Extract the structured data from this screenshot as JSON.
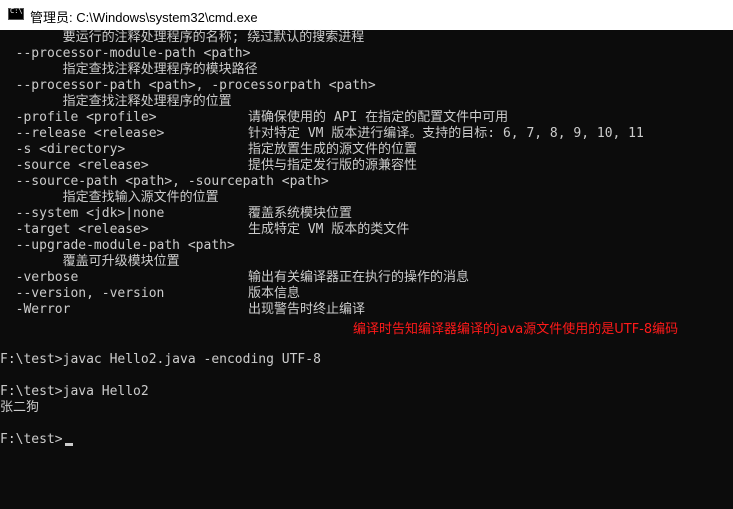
{
  "window": {
    "title": "管理员: C:\\Windows\\system32\\cmd.exe",
    "icon": "cmd-icon"
  },
  "console": {
    "lines": [
      {
        "opt": "        要运行的注释处理程序的名称; 绕过默认的搜索进程",
        "desc": ""
      },
      {
        "opt": "  --processor-module-path <path>",
        "desc": ""
      },
      {
        "opt": "        指定查找注释处理程序的模块路径",
        "desc": ""
      },
      {
        "opt": "  --processor-path <path>, -processorpath <path>",
        "desc": ""
      },
      {
        "opt": "        指定查找注释处理程序的位置",
        "desc": ""
      },
      {
        "opt": "  -profile <profile>",
        "desc": "请确保使用的 API 在指定的配置文件中可用"
      },
      {
        "opt": "  --release <release>",
        "desc": "针对特定 VM 版本进行编译。支持的目标: 6, 7, 8, 9, 10, 11"
      },
      {
        "opt": "  -s <directory>",
        "desc": "指定放置生成的源文件的位置"
      },
      {
        "opt": "  -source <release>",
        "desc": "提供与指定发行版的源兼容性"
      },
      {
        "opt": "  --source-path <path>, -sourcepath <path>",
        "desc": ""
      },
      {
        "opt": "        指定查找输入源文件的位置",
        "desc": ""
      },
      {
        "opt": "  --system <jdk>|none",
        "desc": "覆盖系统模块位置"
      },
      {
        "opt": "  -target <release>",
        "desc": "生成特定 VM 版本的类文件"
      },
      {
        "opt": "  --upgrade-module-path <path>",
        "desc": ""
      },
      {
        "opt": "        覆盖可升级模块位置",
        "desc": ""
      },
      {
        "opt": "  -verbose",
        "desc": "输出有关编译器正在执行的操作的消息"
      },
      {
        "opt": "  --version, -version",
        "desc": "版本信息"
      },
      {
        "opt": "  -Werror",
        "desc": "出现警告时终止编译"
      },
      {
        "opt": "",
        "desc": ""
      },
      {
        "opt": "",
        "desc": ""
      },
      {
        "opt": "F:\\test>javac Hello2.java -encoding UTF-8",
        "desc": ""
      },
      {
        "opt": "",
        "desc": ""
      },
      {
        "opt": "F:\\test>java Hello2",
        "desc": ""
      },
      {
        "opt": "张二狗",
        "desc": ""
      },
      {
        "opt": "",
        "desc": ""
      },
      {
        "opt": "F:\\test>",
        "desc": ""
      }
    ],
    "annotation": "编译时告知编译器编译的java源文件使用的是UTF-8编码",
    "annotation_color": "#ff1a1a",
    "text_color": "#cccccc",
    "background": "#0c0c0c"
  }
}
